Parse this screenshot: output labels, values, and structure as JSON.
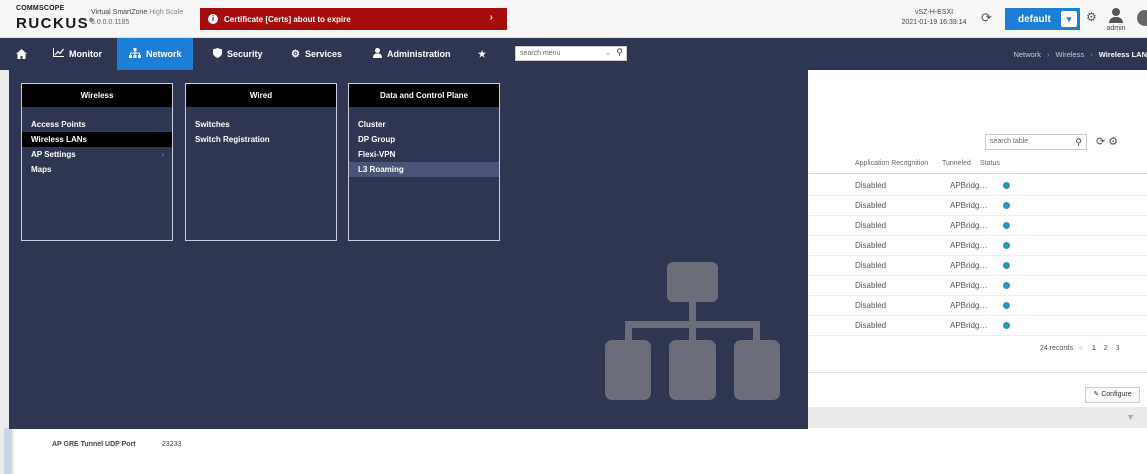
{
  "header": {
    "brand_top": "COMMSCOPE",
    "brand_main": "RUCKUS",
    "brand_reg": "®",
    "product_name": "Virtual SmartZone",
    "product_suffix": "High Scale",
    "version": "6.0.0.0.1185",
    "alert_text": "Certificate [Certs] about to expire",
    "alert_arrow": "›",
    "host_name": "vSZ-H-ESXI",
    "host_time": "2021-01-19 16:39:14",
    "domain_label": "default",
    "user_label": "admin"
  },
  "nav": {
    "items": [
      {
        "label": "Monitor"
      },
      {
        "label": "Network"
      },
      {
        "label": "Security"
      },
      {
        "label": "Services"
      },
      {
        "label": "Administration"
      }
    ],
    "search_placeholder": "search menu",
    "breadcrumb": [
      "Network",
      "Wireless",
      "Wireless LAN"
    ]
  },
  "mega_menu": {
    "columns": [
      {
        "title": "Wireless",
        "items": [
          "Access Points",
          "Wireless LANs",
          "AP Settings",
          "Maps"
        ]
      },
      {
        "title": "Wired",
        "items": [
          "Switches",
          "Switch Registration"
        ]
      },
      {
        "title": "Data and Control Plane",
        "items": [
          "Cluster",
          "DP Group",
          "Flexi-VPN",
          "L3 Roaming"
        ]
      }
    ]
  },
  "background": {
    "table_search_placeholder": "search table",
    "columns": [
      "Application Recognition",
      "Tunneled",
      "Status"
    ],
    "rows": [
      {
        "app_recognition": "Disabled",
        "tunneled": "APBridg…"
      },
      {
        "app_recognition": "Disabled",
        "tunneled": "APBridg…"
      },
      {
        "app_recognition": "Disabled",
        "tunneled": "APBridg…"
      },
      {
        "app_recognition": "Disabled",
        "tunneled": "APBridg…"
      },
      {
        "app_recognition": "Disabled",
        "tunneled": "APBridg…"
      },
      {
        "app_recognition": "Disabled",
        "tunneled": "APBridg…"
      },
      {
        "app_recognition": "Disabled",
        "tunneled": "APBridg…"
      },
      {
        "app_recognition": "Disabled",
        "tunneled": "APBridg…"
      }
    ],
    "records_text": "24 records",
    "pages": [
      "1",
      "2",
      "3"
    ],
    "configure_label": "Configure",
    "field_label": "AP GRE Tunnel UDP Port",
    "field_value": "23233"
  },
  "colors": {
    "nav_bg": "#2f3651",
    "accent": "#1c7ed6",
    "alert": "#a50d0d",
    "status_dot": "#2496b6"
  }
}
